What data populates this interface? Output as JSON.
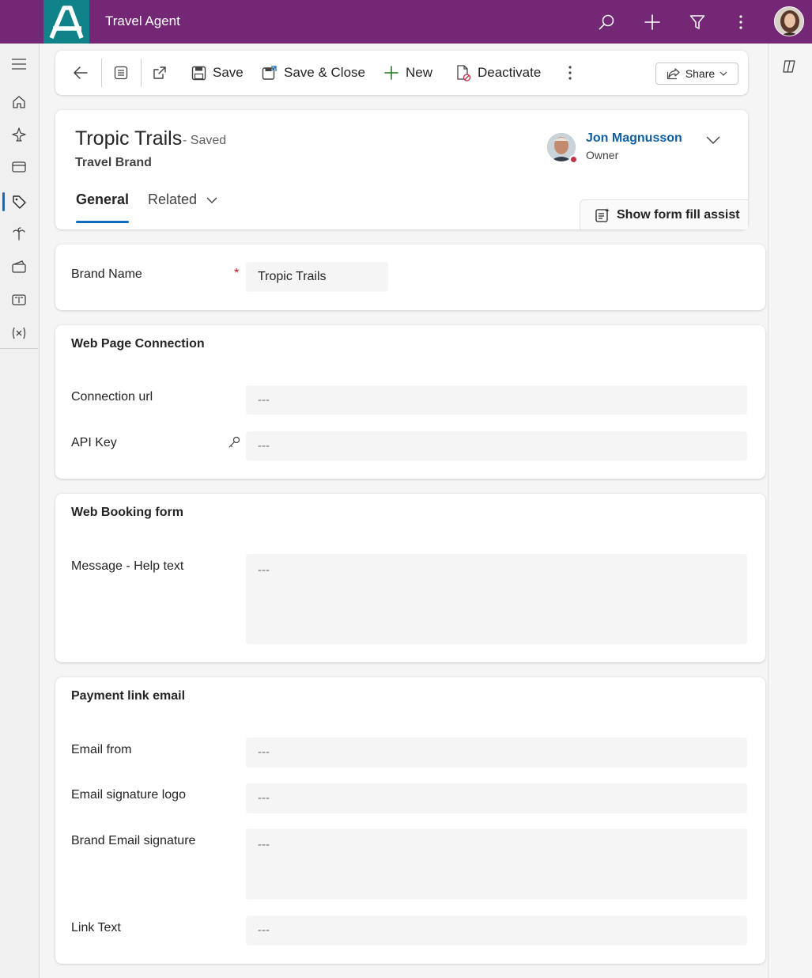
{
  "app": {
    "title": "Travel Agent"
  },
  "topbar": {
    "icons": [
      "search-icon",
      "add-icon",
      "filter-icon",
      "more-vertical-icon",
      "user-avatar"
    ]
  },
  "leftnav": {
    "items": [
      "menu-icon",
      "home-icon",
      "airplane-icon",
      "card-icon",
      "tag-icon",
      "palm-tree-icon",
      "ticket-icon",
      "book-icon",
      "variable-icon"
    ],
    "selected": "tag-icon"
  },
  "commandbar": {
    "save_label": "Save",
    "save_close_label": "Save & Close",
    "new_label": "New",
    "deactivate_label": "Deactivate",
    "share_label": "Share"
  },
  "record": {
    "title": "Tropic Trails",
    "status": "- Saved",
    "entity": "Travel Brand",
    "owner_name": "Jon Magnusson",
    "owner_role": "Owner",
    "fill_assist_label": "Show form fill assist"
  },
  "tabs": {
    "general": "General",
    "related": "Related"
  },
  "sections": {
    "main": {
      "brand_name_label": "Brand Name",
      "required_marker": "*",
      "brand_name_value": "Tropic Trails"
    },
    "web_page": {
      "title": "Web Page Connection",
      "connection_url_label": "Connection url",
      "connection_url_value": "---",
      "api_key_label": "API Key",
      "api_key_value": "---"
    },
    "web_booking": {
      "title": "Web Booking form",
      "message_label": "Message - Help text",
      "message_value": "---"
    },
    "payment": {
      "title": "Payment link email",
      "email_from_label": "Email from",
      "email_from_value": "---",
      "signature_logo_label": "Email signature logo",
      "signature_logo_value": "---",
      "brand_signature_label": "Brand Email signature",
      "brand_signature_value": "---",
      "link_text_label": "Link Text",
      "link_text_value": "---"
    }
  },
  "colors": {
    "topbar": "#742774",
    "logo": "#0f8387",
    "accent": "#0f6cbd",
    "required": "#c50f1f",
    "add_green": "#107c10"
  }
}
